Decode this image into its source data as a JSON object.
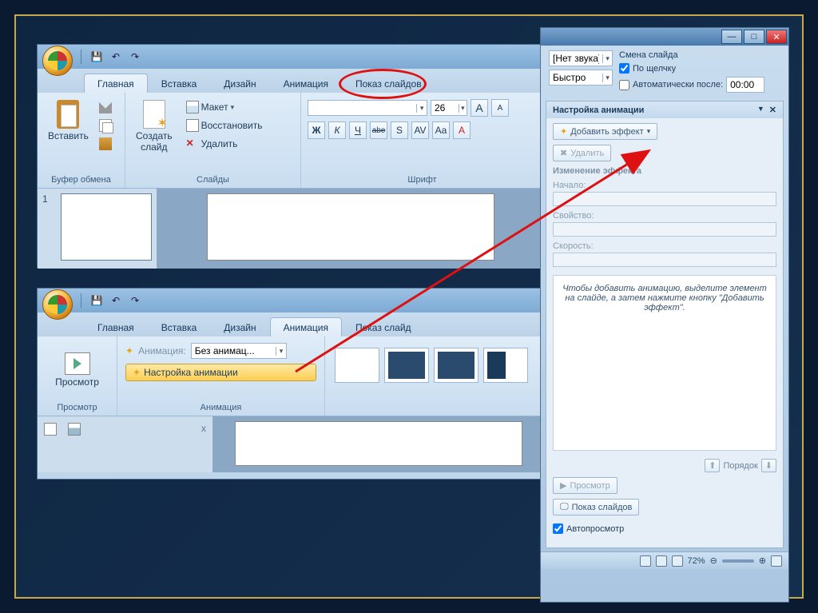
{
  "shot_a": {
    "tabs": [
      "Главная",
      "Вставка",
      "Дизайн",
      "Анимация",
      "Показ слайдов"
    ],
    "active_tab_index": 0,
    "clipboard": {
      "paste": "Вставить",
      "title": "Буфер обмена"
    },
    "slides": {
      "new": "Создать\nслайд",
      "layout": "Макет",
      "reset": "Восстановить",
      "delete": "Удалить",
      "title": "Слайды"
    },
    "font": {
      "size": "26",
      "buttons": [
        "Ж",
        "К",
        "Ч",
        "abe",
        "S",
        "AV",
        "Aa",
        "A"
      ],
      "grow": "A",
      "shrink": "A",
      "title": "Шрифт"
    },
    "slide_num": "1"
  },
  "shot_b": {
    "tabs": [
      "Главная",
      "Вставка",
      "Дизайн",
      "Анимация",
      "Показ слайд"
    ],
    "active_tab_index": 3,
    "preview": "Просмотр",
    "preview_title": "Просмотр",
    "anim_label": "Анимация:",
    "anim_value": "Без анимац...",
    "custom_anim": "Настройка анимации",
    "group_title": "Анимация"
  },
  "shot_c": {
    "sound": "[Нет звука]",
    "speed": "Быстро",
    "advance_title": "Смена слайда",
    "on_click": "По щелчку",
    "auto_after": "Автоматически после:",
    "auto_time": "00:00",
    "pane_title": "Настройка анимации",
    "add_effect": "Добавить эффект",
    "remove": "Удалить",
    "change_title": "Изменение эффекта",
    "start": "Начало:",
    "property": "Свойство:",
    "speed_lbl": "Скорость:",
    "hint": "Чтобы добавить анимацию, выделите элемент на слайде, а затем нажмите кнопку \"Добавить эффект\".",
    "order": "Порядок",
    "play": "Просмотр",
    "slideshow": "Показ слайдов",
    "autoplay": "Автопросмотр",
    "zoom": "72%"
  }
}
